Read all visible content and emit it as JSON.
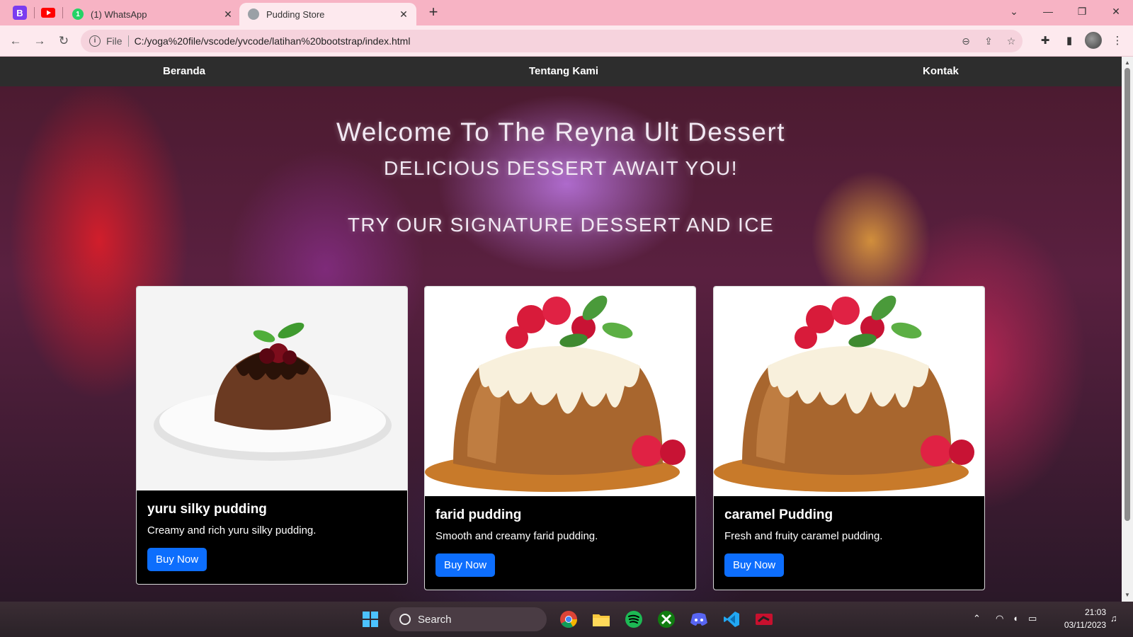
{
  "browser": {
    "tabs": [
      {
        "label": "(1) WhatsApp",
        "close": "✕"
      },
      {
        "label": "Pudding Store",
        "close": "✕"
      }
    ],
    "new_tab": "+",
    "address": {
      "scheme": "File",
      "url": "C:/yoga%20file/vscode/yvcode/latihan%20bootstrap/index.html"
    }
  },
  "site": {
    "nav": [
      "Beranda",
      "Tentang Kami",
      "Kontak"
    ],
    "hero": {
      "title": "Welcome To The Reyna Ult Dessert",
      "subtitle1": "DELICIOUS DESSERT AWAIT YOU!",
      "subtitle2": "TRY OUR SIGNATURE DESSERT AND ICE"
    },
    "cards": [
      {
        "title": "yuru silky pudding",
        "text": "Creamy and rich yuru silky pudding.",
        "button": "Buy Now"
      },
      {
        "title": "farid pudding",
        "text": "Smooth and creamy farid pudding.",
        "button": "Buy Now"
      },
      {
        "title": "caramel Pudding",
        "text": "Fresh and fruity caramel pudding.",
        "button": "Buy Now"
      }
    ],
    "accent_color": "#0d6efd"
  },
  "taskbar": {
    "search_label": "Search",
    "time": "21:03",
    "date": "03/11/2023"
  }
}
